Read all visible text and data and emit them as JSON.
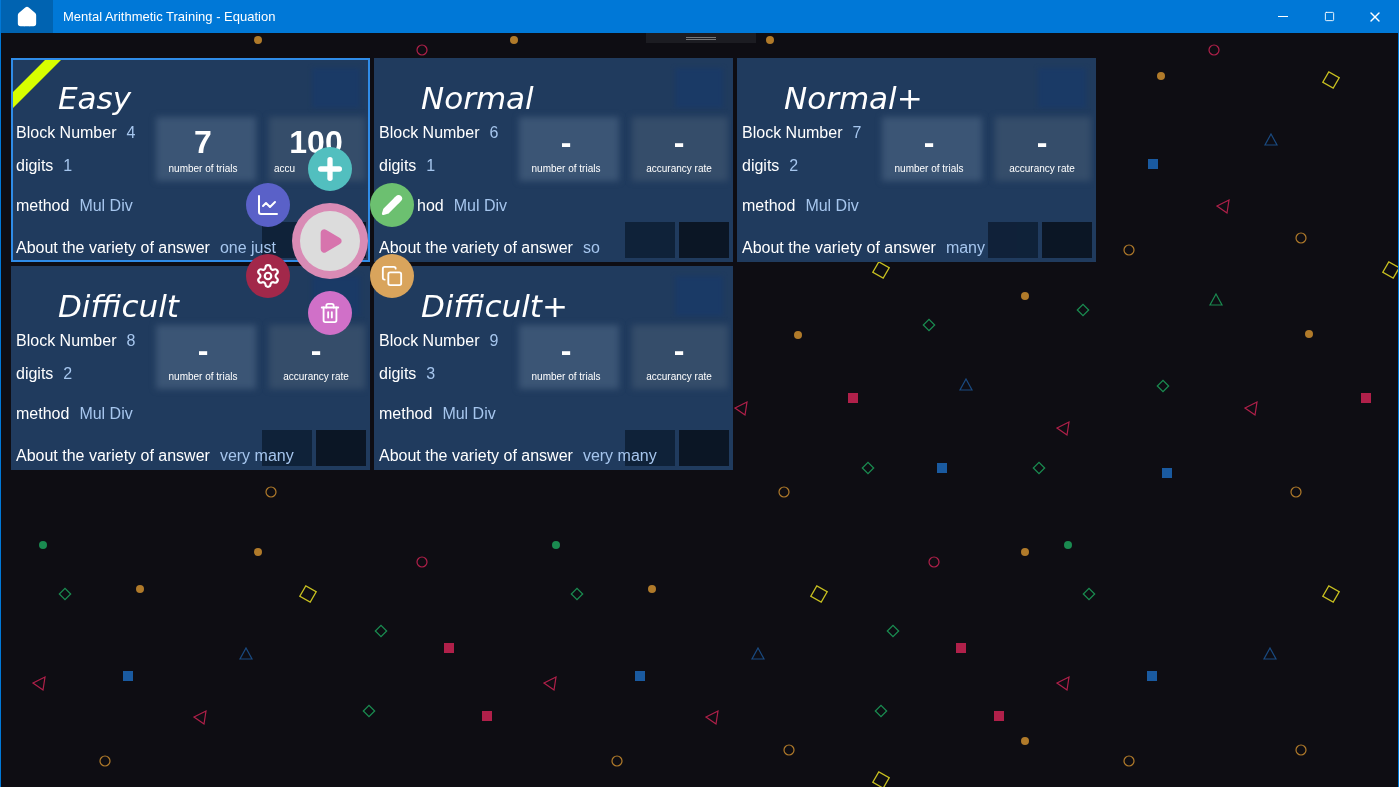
{
  "window": {
    "title": "Mental Arithmetic Training - Equation"
  },
  "cards": [
    {
      "title": "Easy",
      "selected": true,
      "rows": [
        {
          "label": "Block Number",
          "value": "4"
        },
        {
          "label": "digits",
          "value": "1"
        },
        {
          "label": "method",
          "value": "Mul Div"
        },
        {
          "label": "About the variety of answer",
          "value": "one just"
        }
      ],
      "stats": [
        {
          "value": "7",
          "label": "number of trials"
        },
        {
          "value": "100",
          "label": "accu"
        }
      ]
    },
    {
      "title": "Normal",
      "selected": false,
      "rows": [
        {
          "label": "Block Number",
          "value": "6"
        },
        {
          "label": "digits",
          "value": "1"
        },
        {
          "label": "hod",
          "value": "Mul Div"
        },
        {
          "label": "About the variety of answer",
          "value": "so"
        }
      ],
      "stats": [
        {
          "value": "-",
          "label": "number of trials"
        },
        {
          "value": "-",
          "label": "accurancy rate"
        }
      ]
    },
    {
      "title": "Normal+",
      "selected": false,
      "rows": [
        {
          "label": "Block Number",
          "value": "7"
        },
        {
          "label": "digits",
          "value": "2"
        },
        {
          "label": "method",
          "value": "Mul Div"
        },
        {
          "label": "About the variety of answer",
          "value": "many"
        }
      ],
      "stats": [
        {
          "value": "-",
          "label": "number of trials"
        },
        {
          "value": "-",
          "label": "accurancy rate"
        }
      ]
    },
    {
      "title": "Difficult",
      "selected": false,
      "rows": [
        {
          "label": "Block Number",
          "value": "8"
        },
        {
          "label": "digits",
          "value": "2"
        },
        {
          "label": "method",
          "value": "Mul Div"
        },
        {
          "label": "About the variety of answer",
          "value": "very many"
        }
      ],
      "stats": [
        {
          "value": "-",
          "label": "number of trials"
        },
        {
          "value": "-",
          "label": "accurancy rate"
        }
      ]
    },
    {
      "title": "Difficult+",
      "selected": false,
      "rows": [
        {
          "label": "Block Number",
          "value": "9"
        },
        {
          "label": "digits",
          "value": "3"
        },
        {
          "label": "method",
          "value": "Mul Div"
        },
        {
          "label": "About the variety of answer",
          "value": "very many"
        }
      ],
      "stats": [
        {
          "value": "-",
          "label": "number of trials"
        },
        {
          "value": "-",
          "label": "accurancy rate"
        }
      ]
    }
  ]
}
